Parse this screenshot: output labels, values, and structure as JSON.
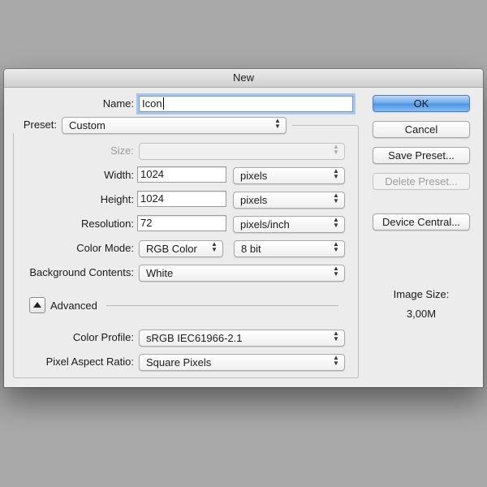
{
  "window": {
    "title": "New"
  },
  "form": {
    "name_label": "Name:",
    "name_value": "Icon",
    "preset_label": "Preset:",
    "preset_value": "Custom",
    "size_label": "Size:",
    "size_value": "",
    "width_label": "Width:",
    "width_value": "1024",
    "width_unit": "pixels",
    "height_label": "Height:",
    "height_value": "1024",
    "height_unit": "pixels",
    "resolution_label": "Resolution:",
    "resolution_value": "72",
    "resolution_unit": "pixels/inch",
    "color_mode_label": "Color Mode:",
    "color_mode_value": "RGB Color",
    "bit_depth_value": "8 bit",
    "background_label": "Background Contents:",
    "background_value": "White",
    "advanced_label": "Advanced",
    "color_profile_label": "Color Profile:",
    "color_profile_value": "sRGB IEC61966-2.1",
    "pixel_aspect_label": "Pixel Aspect Ratio:",
    "pixel_aspect_value": "Square Pixels"
  },
  "buttons": {
    "ok": "OK",
    "cancel": "Cancel",
    "save_preset": "Save Preset...",
    "delete_preset": "Delete Preset...",
    "device_central": "Device Central..."
  },
  "image_size": {
    "label": "Image Size:",
    "value": "3,00M"
  },
  "icons": {
    "popup_arrows": "up-down-arrows-icon",
    "disclosure": "disclosure-triangle-icon"
  },
  "colors": {
    "primary_button": "#5fa2ea",
    "focus_ring": "#a7c6ec",
    "background": "#a9a9a9"
  }
}
